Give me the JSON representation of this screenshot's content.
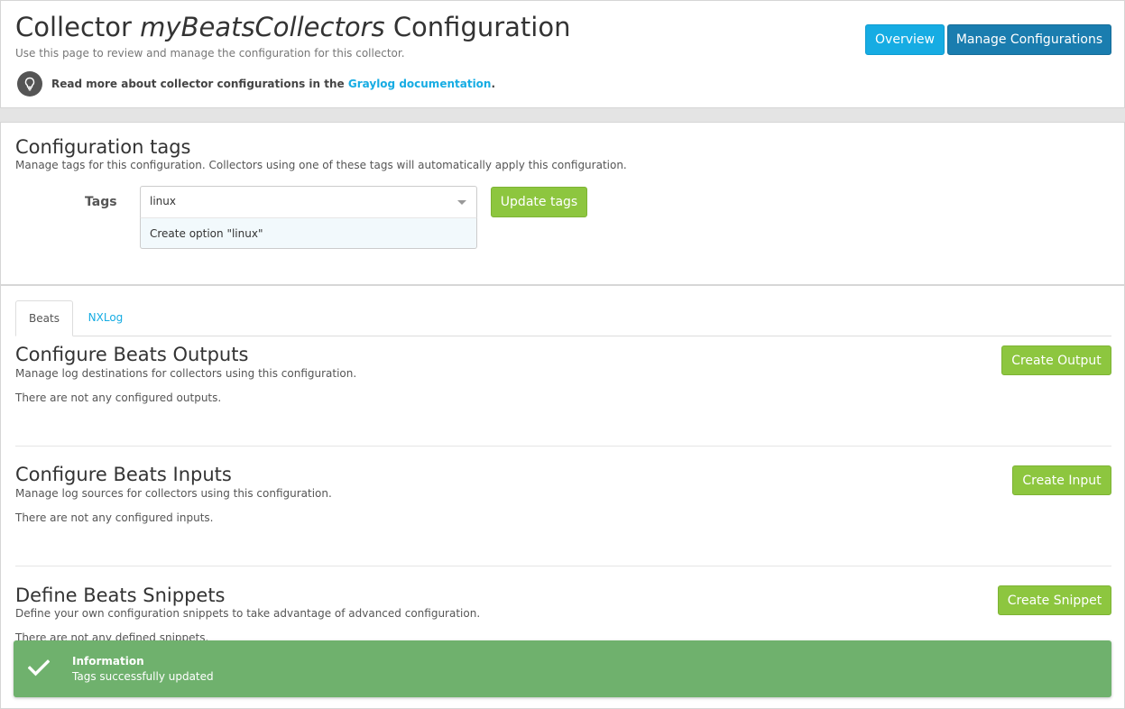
{
  "header": {
    "title_prefix": "Collector",
    "title_name": "myBeatsCollectors",
    "title_suffix": "Configuration",
    "description": "Use this page to review and manage the configuration for this collector.",
    "doc_text_before": "Read more about collector configurations in the",
    "doc_link": "Graylog documentation",
    "doc_text_after": ".",
    "overview_button": "Overview",
    "manage_button": "Manage Configurations"
  },
  "tags": {
    "title": "Configuration tags",
    "description": "Manage tags for this configuration. Collectors using one of these tags will automatically apply this configuration.",
    "label": "Tags",
    "input_value": "linux",
    "create_option": "Create option \"linux\"",
    "update_button": "Update tags"
  },
  "tabs": [
    {
      "label": "Beats",
      "active": true
    },
    {
      "label": "NXLog",
      "active": false
    }
  ],
  "outputs": {
    "title": "Configure Beats Outputs",
    "description": "Manage log destinations for collectors using this configuration.",
    "empty": "There are not any configured outputs.",
    "button": "Create Output"
  },
  "inputs": {
    "title": "Configure Beats Inputs",
    "description": "Manage log sources for collectors using this configuration.",
    "empty": "There are not any configured inputs.",
    "button": "Create Input"
  },
  "snippets": {
    "title": "Define Beats Snippets",
    "description": "Define your own configuration snippets to take advantage of advanced configuration.",
    "empty": "There are not any defined snippets.",
    "button": "Create Snippet"
  },
  "notification": {
    "title": "Information",
    "message": "Tags successfully updated",
    "icon": "check-icon"
  },
  "colors": {
    "info": "#16ace3",
    "primary": "#1a7daf",
    "success": "#8dc63f",
    "toast": "#6fb16d"
  }
}
